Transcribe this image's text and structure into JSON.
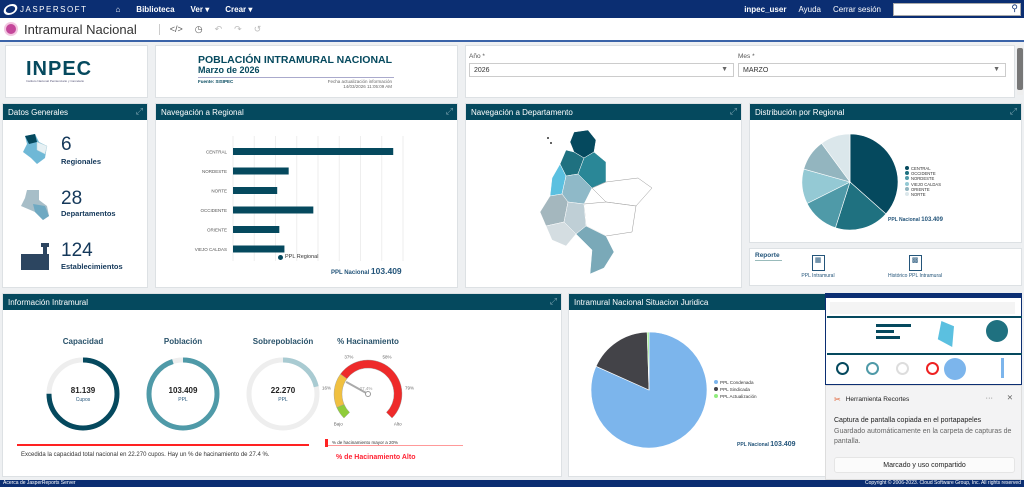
{
  "topbar": {
    "brand": "JASPERSOFT",
    "nav": [
      "Biblioteca",
      "Ver ▾",
      "Crear ▾"
    ],
    "user": "inpec_user",
    "help": "Ayuda",
    "logout": "Cerrar sesión",
    "search_placeholder": ""
  },
  "titlebar": {
    "title": "Intramural Nacional"
  },
  "logo": {
    "name": "INPEC",
    "subtitle": "Instituto Nacional Penitenciario y Carcelario"
  },
  "header": {
    "title": "POBLACIÓN INTRAMURAL NACIONAL",
    "subtitle": "Marzo de 2026",
    "source": "Fuente: SISIPEC",
    "updated_label": "Fecha actualización información",
    "updated": "14/03/2026 11:05:09 AM"
  },
  "filters": {
    "year_label": "Año *",
    "year": "2026",
    "month_label": "Mes *",
    "month": "MARZO"
  },
  "datos": {
    "title": "Datos Generales",
    "items": [
      {
        "value": "6",
        "label": "Regionales"
      },
      {
        "value": "28",
        "label": "Departamentos"
      },
      {
        "value": "124",
        "label": "Establecimientos"
      }
    ]
  },
  "regional": {
    "title": "Navegación a Regional",
    "total_label": "PPL Nacional",
    "total": "103.409"
  },
  "departamento": {
    "title": "Navegación a Departamento"
  },
  "distribucion": {
    "title": "Distribución por Regional",
    "total_label": "PPL Nacional",
    "total": "103.409"
  },
  "reporte": {
    "title": "Reporte",
    "links": [
      "PPL Intramural",
      "Histórico PPL Intramural"
    ]
  },
  "info": {
    "title": "Información Intramural",
    "rings": [
      {
        "title": "Capacidad",
        "value": "81.139",
        "unit": "Cupos",
        "fraction": 0.75,
        "color": "#05495e"
      },
      {
        "title": "Población",
        "value": "103.409",
        "unit": "PPL",
        "fraction": 0.95,
        "color": "#4f9aa8"
      },
      {
        "title": "Sobrepoblación",
        "value": "22.270",
        "unit": "PPL",
        "fraction": 0.215,
        "color": "#a9cbd2"
      }
    ],
    "gauge_title": "% Hacinamiento",
    "gauge_value": 27.4,
    "gauge_value_label": "27,4%",
    "gauge_ticks": [
      "Bajo",
      "16%",
      "37%",
      "58%",
      "79%",
      "Alto"
    ],
    "message": "Excedida la capacidad total nacional en 22.270 cupos.  Hay un % de hacinamiento de 27.4 %.",
    "legend": "% de hacinamiento mayor a 20%",
    "status": "% de Hacinamiento Alto"
  },
  "juridica": {
    "title": "Intramural Nacional Situacion Juridica",
    "total_label": "PPL Nacional",
    "total": "103.409"
  },
  "toast": {
    "app": "Herramienta Recortes",
    "heading": "Captura de pantalla copiada en el portapapeles",
    "body": "Guardado automáticamente en la carpeta de capturas de pantalla.",
    "button": "Marcado y uso compartido"
  },
  "footer": {
    "about": "Acerca de JasperReports Server",
    "copyright": "Copyright © 2006-2023. Cloud Software Group, Inc. All rights reserved"
  },
  "chart_data": [
    {
      "type": "bar",
      "orientation": "horizontal",
      "categories": [
        "CENTRAL",
        "NORDESTE",
        "NORTE",
        "OCCIDENTE",
        "ORIENTE",
        "VIEJO CALDAS"
      ],
      "series": [
        {
          "name": "PPL Regional",
          "values": [
            37700,
            13100,
            10400,
            18900,
            10900,
            12100
          ]
        }
      ],
      "xticks": [
        "0",
        "5.000",
        "10.000",
        "15.000",
        "20.000",
        "25.000",
        "30.000",
        "35.000",
        "40..."
      ],
      "xlim": [
        0,
        40000
      ],
      "color": "#05495e",
      "grid": true,
      "legend": "bottom"
    },
    {
      "type": "pie",
      "categories": [
        "CENTRAL",
        "OCCIDENTE",
        "NORDESTE",
        "VIEJO CALDAS",
        "ORIENTE",
        "NORTE"
      ],
      "values": [
        37700,
        18900,
        13100,
        12100,
        10900,
        10400
      ],
      "colors": [
        "#05495e",
        "#1f7180",
        "#4f9aa8",
        "#94c9d4",
        "#93b5bf",
        "#dbe7eb"
      ],
      "legend": "right"
    },
    {
      "type": "pie",
      "categories": [
        "PPL Condenada",
        "PPL Sindicada",
        "PPL Actualización"
      ],
      "values": [
        81.7,
        17.8,
        0.5
      ],
      "colors": [
        "#7cb5ec",
        "#434348",
        "#90ed7d"
      ],
      "legend": "right"
    }
  ]
}
